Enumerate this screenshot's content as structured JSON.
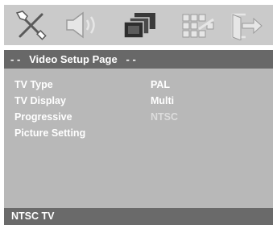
{
  "toolbar": {
    "icons": [
      "tools-icon",
      "speaker-icon",
      "video-screen-icon",
      "preference-grid-icon",
      "exit-icon"
    ]
  },
  "header": {
    "title": "- -   Video Setup Page   - -"
  },
  "menu": {
    "items": [
      {
        "label": "TV Type",
        "value": "PAL"
      },
      {
        "label": "TV Display",
        "value": "Multi"
      },
      {
        "label": "Progressive",
        "value": "NTSC"
      },
      {
        "label": "Picture Setting",
        "value": ""
      }
    ]
  },
  "status": {
    "text": "NTSC TV"
  },
  "colors": {
    "panel": "#b8b8b8",
    "bar": "#686868",
    "toolbar": "#cacaca"
  }
}
